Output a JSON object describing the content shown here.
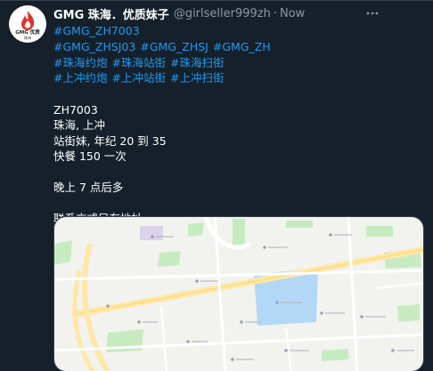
{
  "author": {
    "display_name": "GMG 珠海．优质妹子",
    "handle": "@girlseller999zh",
    "time": "Now",
    "avatar_text": "GMG 优质",
    "avatar_subtext": "珠海"
  },
  "hashtag_lines": [
    [
      "#GMG_ZH7003"
    ],
    [
      "#GMG_ZHSJ03",
      "#GMG_ZHSJ",
      "#GMG_ZH"
    ],
    [
      "#珠海约炮",
      "#珠海站街",
      "#珠海扫街"
    ],
    [
      "#上冲约炮",
      "#上冲站街",
      "#上冲扫街"
    ]
  ],
  "body_lines": [
    "ZH7003",
    "珠海, 上冲",
    "站街妹, 年纪 20 到 35",
    "快餐 150 一次",
    "",
    "晚上 7 点后多",
    "",
    "联系方式只有地址"
  ],
  "icons": {
    "more": "more-options-icon",
    "avatar": "flame-logo-icon"
  },
  "colors": {
    "background": "#15202b",
    "link": "#1d9bf0",
    "muted": "#8b98a5",
    "border": "#38444d",
    "avatar_flame": "#e0312b"
  }
}
